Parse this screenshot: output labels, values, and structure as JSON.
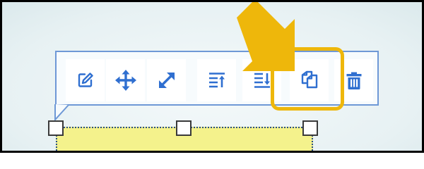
{
  "toolbar": {
    "buttons": [
      {
        "icon": "edit-icon",
        "interactable": true
      },
      {
        "icon": "move-icon",
        "interactable": true
      },
      {
        "icon": "resize-icon",
        "interactable": true
      },
      {
        "icon": "bring-forward-icon",
        "interactable": true
      },
      {
        "icon": "send-backward-icon",
        "interactable": true
      },
      {
        "icon": "duplicate-icon",
        "interactable": true,
        "highlighted": true
      },
      {
        "icon": "delete-icon",
        "interactable": true
      }
    ]
  },
  "colors": {
    "icon_blue": "#2f6fd0",
    "toolbar_border": "#6e98d6",
    "highlight": "#eeb70b",
    "shape_fill": "#f4f28c",
    "shape_outline": "#2a4f86"
  }
}
